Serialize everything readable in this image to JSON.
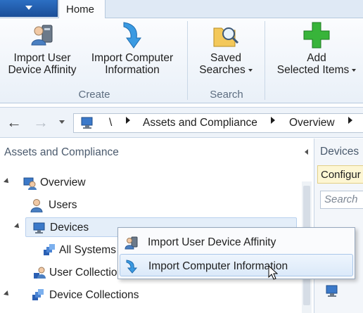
{
  "ribbon": {
    "home_tab": "Home",
    "buttons": {
      "import_user_affinity": {
        "line1": "Import User",
        "line2": "Device Affinity"
      },
      "import_computer": {
        "line1": "Import Computer",
        "line2": "Information"
      },
      "saved_searches": {
        "line1": "Saved",
        "line2": "Searches"
      },
      "add_selected": {
        "line1": "Add",
        "line2": "Selected Items"
      }
    },
    "groups": {
      "create": "Create",
      "search": "Search"
    }
  },
  "nav": {
    "root": "\\",
    "crumbs": [
      "Assets and Compliance",
      "Overview"
    ]
  },
  "left_pane": {
    "title": "Assets and Compliance",
    "tree": {
      "overview": "Overview",
      "users": "Users",
      "devices": "Devices",
      "all_systems": "All Systems",
      "user_collections": "User Collections",
      "device_collections": "Device Collections"
    }
  },
  "right_pane": {
    "title": "Devices",
    "config": "Configur",
    "search_placeholder": "Search"
  },
  "context_menu": {
    "items": [
      "Import User Device Affinity",
      "Import Computer Information"
    ],
    "hovered_index": 1
  },
  "colors": {
    "accent": "#1a4e98",
    "ribbon_bg": "#e9f0f8",
    "selection": "#e4eef9",
    "hover": "#dbe9f9"
  }
}
